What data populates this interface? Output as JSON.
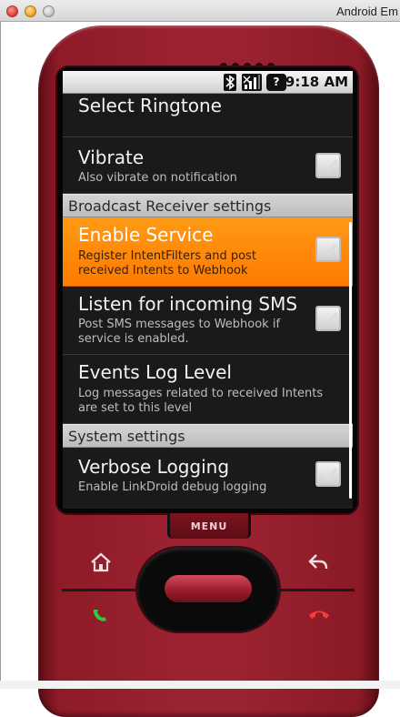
{
  "window": {
    "title": "Android Em"
  },
  "status_bar": {
    "time": "9:18 AM",
    "icons": [
      "bluetooth-icon",
      "signal-icon",
      "help-icon"
    ]
  },
  "settings": {
    "ringtone": {
      "title": "Select Ringtone"
    },
    "vibrate": {
      "title": "Vibrate",
      "summary": "Also vibrate on notification",
      "checked": false
    },
    "broadcast_category": "Broadcast Receiver settings",
    "enable_service": {
      "title": "Enable Service",
      "summary": "Register IntentFilters and post received Intents to Webhook",
      "checked": false
    },
    "listen_sms": {
      "title": "Listen for incoming SMS",
      "summary": "Post SMS messages to Webhook if service is enabled.",
      "checked": false
    },
    "events_log": {
      "title": "Events Log Level",
      "summary": "Log messages related to received Intents are set to this level"
    },
    "system_category": "System settings",
    "verbose_logging": {
      "title": "Verbose Logging",
      "summary": "Enable LinkDroid debug logging",
      "checked": false
    }
  },
  "hardware": {
    "menu_label": "MENU",
    "icons": [
      "home-icon",
      "back-icon",
      "call-icon",
      "end-call-icon"
    ],
    "colors": {
      "body": "#9b2231",
      "call": "#2ecc40",
      "end_call": "#ff3a3a"
    }
  },
  "colors": {
    "highlight": "#ff8a00",
    "screen_background": "#1a1a1a",
    "category_background": "#c8c8c8"
  }
}
